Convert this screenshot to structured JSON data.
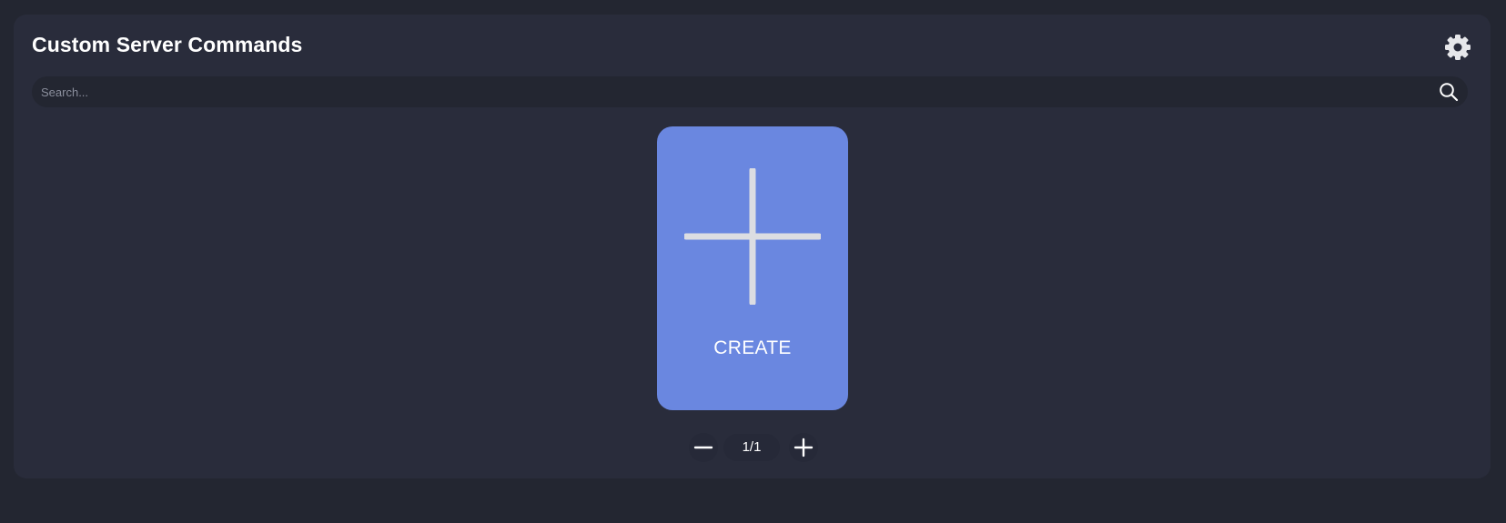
{
  "panel": {
    "title": "Custom Server Commands"
  },
  "header": {
    "settings_icon": "gear-icon"
  },
  "search": {
    "placeholder": "Search...",
    "value": "",
    "icon": "search-icon"
  },
  "create_card": {
    "label": "CREATE",
    "icon": "plus-icon"
  },
  "pagination": {
    "indicator": "1/1",
    "prev_icon": "minus-icon",
    "next_icon": "plus-icon"
  },
  "colors": {
    "background": "#232631",
    "panel": "#292c3b",
    "accent": "#6a87e0",
    "text": "#ffffff"
  }
}
